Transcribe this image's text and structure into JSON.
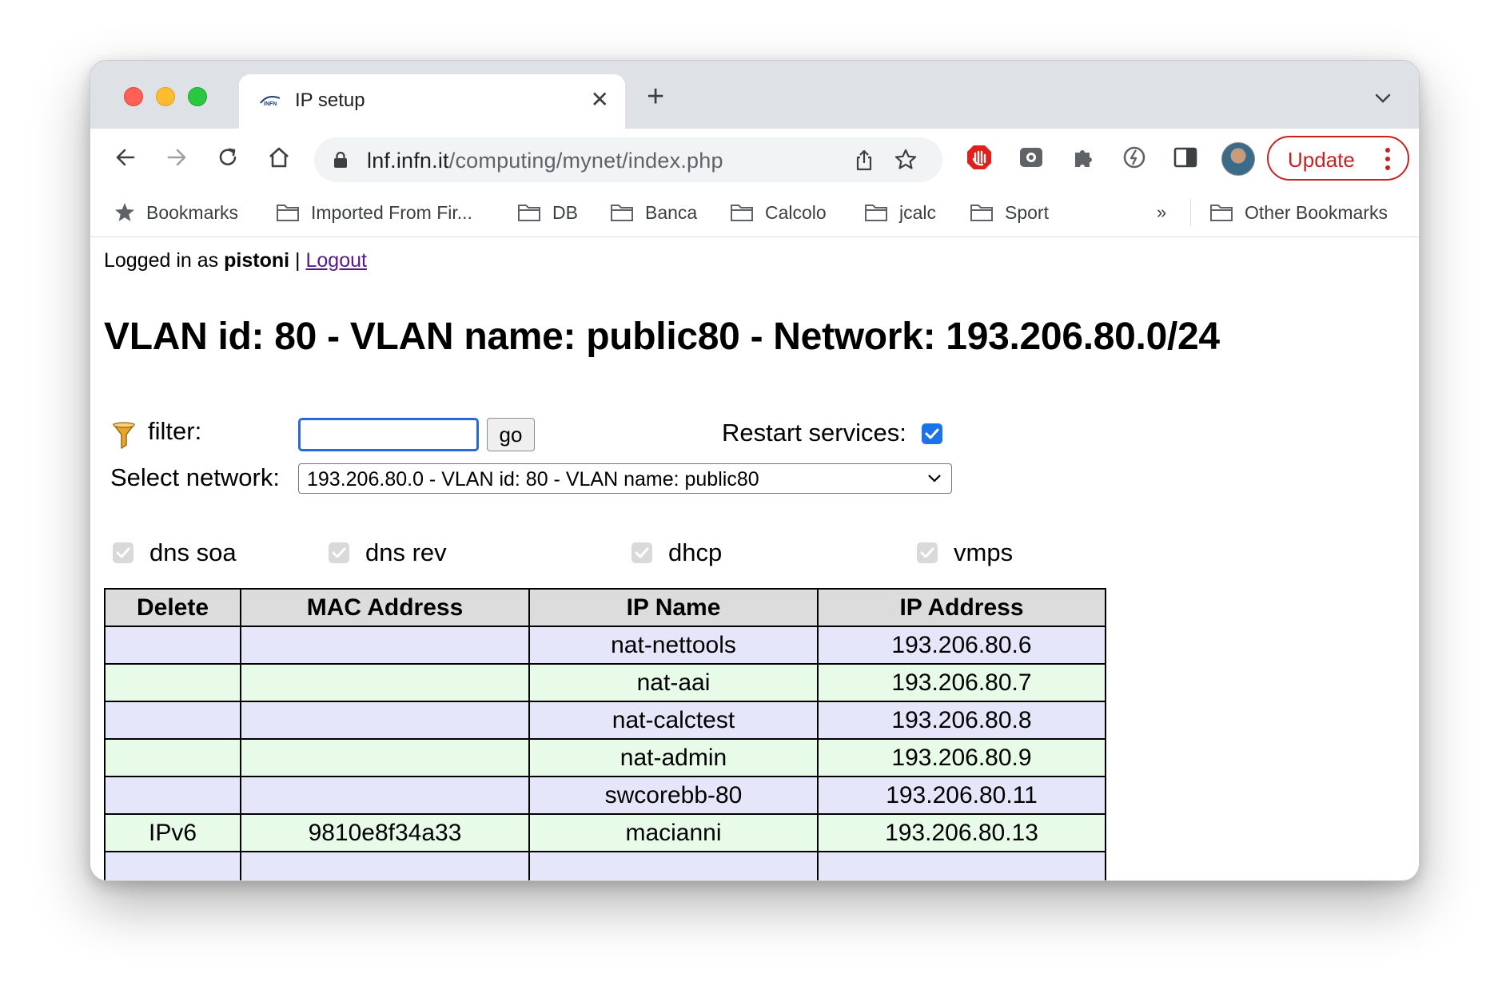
{
  "browser": {
    "tab": {
      "title": "IP setup",
      "favicon": "infn-logo-icon"
    },
    "url": {
      "host": "lnf.infn.it",
      "path": "/computing/mynet/index.php"
    },
    "update_label": "Update",
    "bookmarks": [
      {
        "label": "Bookmarks",
        "icon": "star-icon"
      },
      {
        "label": "Imported From Fir...",
        "icon": "folder-icon"
      },
      {
        "label": "DB",
        "icon": "folder-icon"
      },
      {
        "label": "Banca",
        "icon": "folder-icon"
      },
      {
        "label": "Calcolo",
        "icon": "folder-icon"
      },
      {
        "label": "jcalc",
        "icon": "folder-icon"
      },
      {
        "label": "Sport",
        "icon": "folder-icon"
      }
    ],
    "bookmarks_more": "»",
    "other_bookmarks": "Other Bookmarks"
  },
  "page": {
    "login": {
      "prefix": "Logged in as",
      "user": "pistoni",
      "separator": "|",
      "logout": "Logout"
    },
    "title": "VLAN id: 80 - VLAN name: public80 - Network: 193.206.80.0/24",
    "filter": {
      "label": "filter:",
      "value": "",
      "go_label": "go"
    },
    "restart": {
      "label": "Restart services:",
      "checked": true
    },
    "select_network": {
      "label": "Select network:",
      "value": "193.206.80.0 - VLAN id: 80 - VLAN name: public80"
    },
    "options": [
      {
        "label": "dns soa",
        "checked": true
      },
      {
        "label": "dns rev",
        "checked": true
      },
      {
        "label": "dhcp",
        "checked": true
      },
      {
        "label": "vmps",
        "checked": true
      }
    ],
    "table": {
      "headers": [
        "Delete",
        "MAC Address",
        "IP Name",
        "IP Address"
      ],
      "rows": [
        {
          "delete": "",
          "mac": "",
          "name": "nat-nettools",
          "ip": "193.206.80.6"
        },
        {
          "delete": "",
          "mac": "",
          "name": "nat-aai",
          "ip": "193.206.80.7"
        },
        {
          "delete": "",
          "mac": "",
          "name": "nat-calctest",
          "ip": "193.206.80.8"
        },
        {
          "delete": "",
          "mac": "",
          "name": "nat-admin",
          "ip": "193.206.80.9"
        },
        {
          "delete": "",
          "mac": "",
          "name": "swcorebb-80",
          "ip": "193.206.80.11"
        },
        {
          "delete": "IPv6",
          "mac": "9810e8f34a33",
          "name": "macianni",
          "ip": "193.206.80.13"
        }
      ]
    }
  }
}
